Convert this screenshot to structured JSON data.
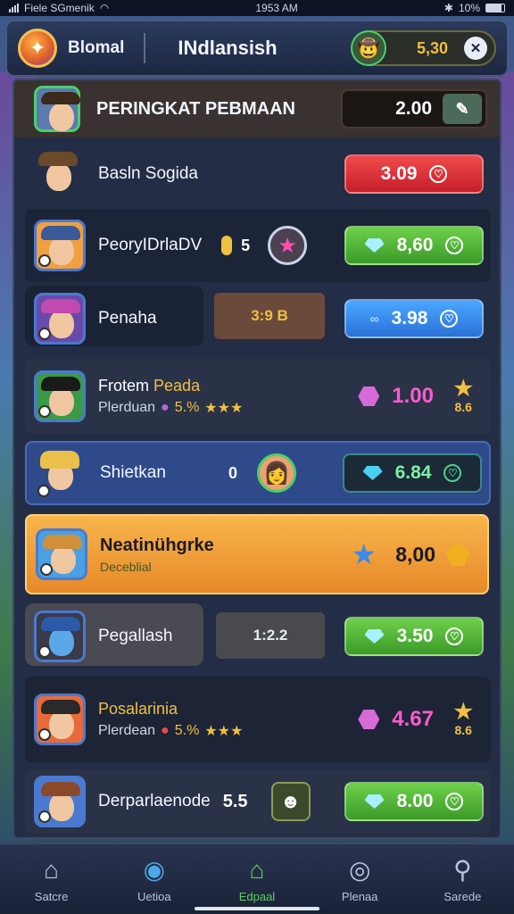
{
  "status_bar": {
    "carrier": "Fiele SGmenik",
    "time": "1953 AM",
    "battery": "10%"
  },
  "header": {
    "app_name": "Blomal",
    "title": "INdlansish",
    "balance": "5,30",
    "close_icon": "close-icon"
  },
  "leaderboard": {
    "header_row": {
      "title": "PERINGKAT PEBMAAN",
      "value": "2.00"
    },
    "rows": [
      {
        "name": "Basln Sogida",
        "value": "3.09"
      },
      {
        "name": "PeoryIDrlaDV",
        "tag": "5",
        "value": "8,60"
      },
      {
        "name": "Penaha",
        "tag": "3:9 B",
        "value": "3.98"
      },
      {
        "name": "Frotem",
        "name_highlight": "Peada",
        "sub": "Plerduan",
        "sub_pct": "5.%",
        "value": "1.00",
        "stars_count": "8.6"
      },
      {
        "name": "Shietkan",
        "tag": "0",
        "value": "6.84"
      },
      {
        "name": "Neatinühgrke",
        "sub": "Deceblial",
        "value": "8,00"
      },
      {
        "name": "Pegallash",
        "tag": "1:2.2",
        "value": "3.50"
      },
      {
        "name": "Posalarinia",
        "sub": "Plerdean",
        "sub_pct": "5.%",
        "value": "4.67",
        "stars_count": "8.6"
      },
      {
        "name": "Derparlaenode",
        "tag": "5.5",
        "value": "8.00"
      }
    ]
  },
  "tabs": [
    {
      "label": "Satcre",
      "icon": "house-icon"
    },
    {
      "label": "Uetioa",
      "icon": "globe-icon"
    },
    {
      "label": "Edpaal",
      "icon": "home-icon"
    },
    {
      "label": "Plenaa",
      "icon": "target-icon"
    },
    {
      "label": "Sarede",
      "icon": "search-icon"
    }
  ],
  "colors": {
    "accent": "#f0c040",
    "active_tab": "#5ad05a",
    "highlight_row": "#f2a33a"
  }
}
